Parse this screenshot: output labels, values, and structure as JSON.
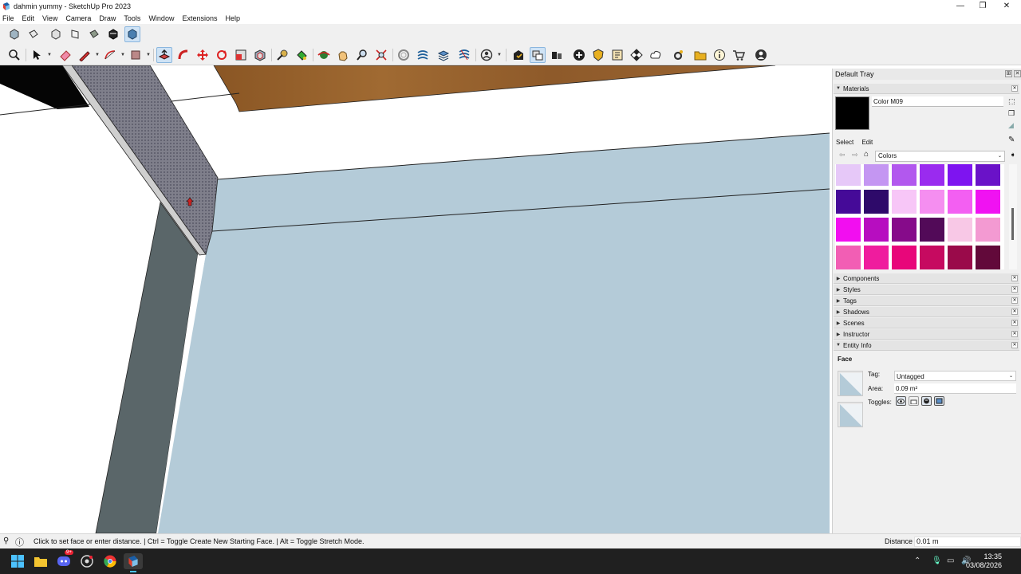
{
  "window": {
    "title": "dahmin yummy - SketchUp Pro 2023"
  },
  "menu": [
    "File",
    "Edit",
    "View",
    "Camera",
    "Draw",
    "Tools",
    "Window",
    "Extensions",
    "Help"
  ],
  "tray": {
    "title": "Default Tray",
    "materials": {
      "header": "Materials",
      "current_name": "Color M09",
      "current_color": "#000000",
      "tabs": [
        "Select",
        "Edit"
      ],
      "collection": "Colors",
      "swatches": [
        [
          "#e6c8f8",
          "#c496f2",
          "#b258ee",
          "#9a2bef",
          "#7e14f0",
          "#6a12c8"
        ],
        [
          "#450a98",
          "#2e0a6a",
          "#f7c6f7",
          "#f58ef0",
          "#f35ff2",
          "#f012f2"
        ],
        [
          "#f20ef0",
          "#b70dc0",
          "#860b8a",
          "#520a58",
          "#f8c8e6",
          "#f39ad2"
        ],
        [
          "#f25eb4",
          "#ef1c9e",
          "#e8067a",
          "#c60a60",
          "#9a0a4a",
          "#62093a"
        ]
      ]
    },
    "panels": [
      "Components",
      "Styles",
      "Tags",
      "Shadows",
      "Scenes",
      "Instructor",
      "Entity Info"
    ],
    "entity_info": {
      "title": "Face",
      "tag_label": "Tag:",
      "tag_value": "Untagged",
      "area_label": "Area:",
      "area_value": "0.09 m²",
      "toggles_label": "Toggles:"
    }
  },
  "status": {
    "hint": "Click to set face or enter distance. | Ctrl = Toggle Create New Starting Face. | Alt = Toggle Stretch Mode.",
    "distance_label": "Distance",
    "distance_value": "0.01 m"
  },
  "taskbar": {
    "time": "13:35",
    "date": "03/08/2026",
    "badge": "9+"
  },
  "colors": {
    "wall_blue": "#b4cbd8",
    "wall_dark": "#5a6669",
    "wood": "#8e5a2a",
    "accent": "#1a73e8"
  }
}
